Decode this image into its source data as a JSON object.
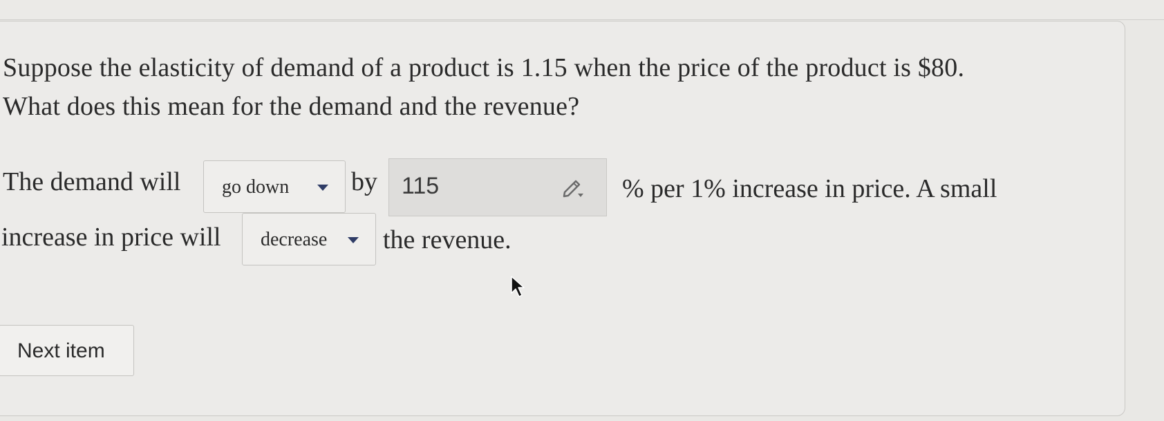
{
  "question": {
    "line1": "Suppose the elasticity of demand of a product is 1.15 when the price of the product is $80.",
    "line2": "What does this mean for the demand and the revenue?"
  },
  "answer": {
    "prefix_1": "The demand will",
    "select_1_value": "go down",
    "by_text": "by",
    "percent_value": "115",
    "suffix_1": "% per 1% increase in price. A small",
    "prefix_2": "increase in price will",
    "select_2_value": "decrease",
    "suffix_2": "the revenue."
  },
  "buttons": {
    "next_label": "Next item"
  },
  "icons": {
    "select_caret": "caret-down-icon",
    "input_edit": "pencil-icon",
    "mouse": "mouse-pointer-icon"
  },
  "colors": {
    "caret": "#2f3c66",
    "panel_bg": "#ecebe9",
    "input_bg": "#dedddb"
  }
}
